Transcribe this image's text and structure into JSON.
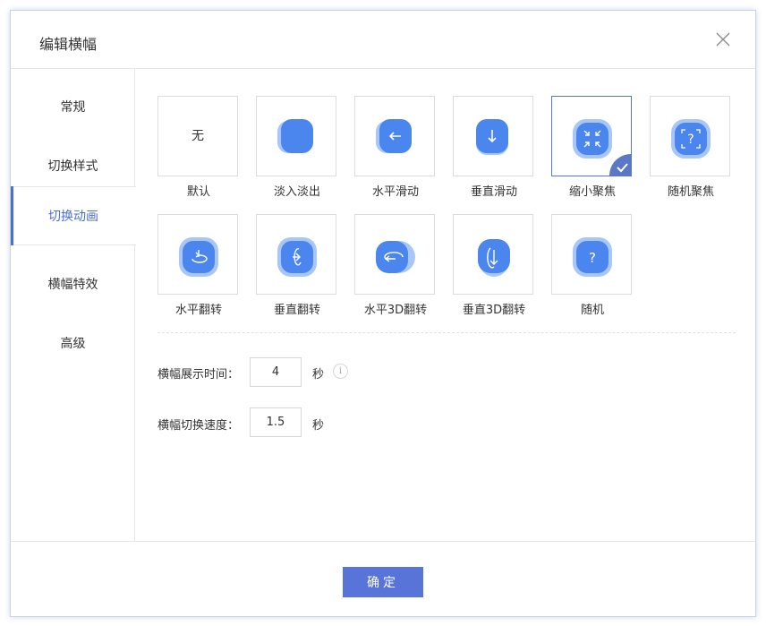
{
  "dialog": {
    "title": "编辑横幅"
  },
  "sidebar": {
    "items": [
      {
        "label": "常规"
      },
      {
        "label": "切换样式"
      },
      {
        "label": "切换动画",
        "active": true
      },
      {
        "label": "横幅特效"
      },
      {
        "label": "高级"
      }
    ]
  },
  "animations": [
    {
      "label": "默认",
      "icon": "none-text",
      "icon_text": "无"
    },
    {
      "label": "淡入淡出",
      "icon": "fade-icon"
    },
    {
      "label": "水平滑动",
      "icon": "arrow-left-icon"
    },
    {
      "label": "垂直滑动",
      "icon": "arrow-down-icon"
    },
    {
      "label": "缩小聚焦",
      "icon": "shrink-focus-icon",
      "selected": true
    },
    {
      "label": "随机聚焦",
      "icon": "random-focus-icon"
    },
    {
      "label": "水平翻转",
      "icon": "horizontal-flip-icon"
    },
    {
      "label": "垂直翻转",
      "icon": "vertical-flip-icon"
    },
    {
      "label": "水平3D翻转",
      "icon": "horizontal-3d-flip-icon"
    },
    {
      "label": "垂直3D翻转",
      "icon": "vertical-3d-flip-icon"
    },
    {
      "label": "随机",
      "icon": "question-icon"
    }
  ],
  "settings": {
    "display_time_label": "横幅展示时间：",
    "display_time_value": "4",
    "display_time_unit": "秒",
    "switch_speed_label": "横幅切换速度：",
    "switch_speed_value": "1.5",
    "switch_speed_unit": "秒",
    "info_icon_text": "i"
  },
  "footer": {
    "ok_label": "确定"
  },
  "colors": {
    "accent": "#5874d8",
    "icon_blue": "#4a86ee",
    "icon_light": "#a8c6f7"
  }
}
